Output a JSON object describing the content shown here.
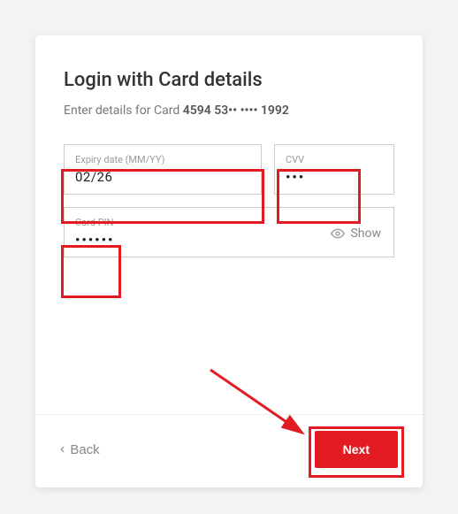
{
  "title": "Login with Card details",
  "subtitle_prefix": "Enter details for Card ",
  "card_mask": "4594 53•• •••• 1992",
  "fields": {
    "expiry": {
      "label": "Expiry date (MM/YY)",
      "value": "02/26"
    },
    "cvv": {
      "label": "CVV",
      "value": "•••"
    },
    "pin": {
      "label": "Card PIN",
      "value": "••••••",
      "show_label": "Show"
    }
  },
  "buttons": {
    "back": "Back",
    "next": "Next"
  },
  "colors": {
    "accent": "#e31b23"
  }
}
